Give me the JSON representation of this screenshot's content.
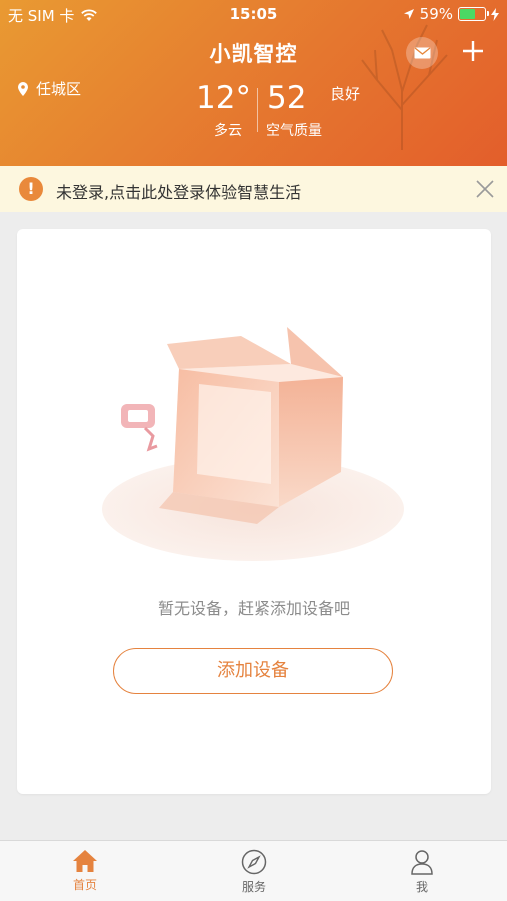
{
  "status_bar": {
    "carrier": "无 SIM 卡",
    "time": "15:05",
    "battery": "59%",
    "battery_level": 0.59,
    "wifi_icon": "wifi-icon",
    "location_icon": "location-arrow-icon"
  },
  "header": {
    "title": "小凯智控",
    "location": "任城区",
    "temperature": "12°",
    "weather": "多云",
    "aqi_value": "52",
    "aqi_label": "空气质量",
    "aqi_level": "良好",
    "mail_icon": "mail-icon",
    "add_icon": "plus-icon",
    "accent_color": "#e5772f"
  },
  "banner": {
    "text": "未登录,点击此处登录体验智慧生活",
    "icon": "warning-icon",
    "close_icon": "close-icon"
  },
  "main": {
    "empty_text": "暂无设备，赶紧添加设备吧",
    "add_button": "添加设备"
  },
  "tabbar": {
    "items": [
      {
        "label": "首页",
        "icon": "home-icon",
        "active": true
      },
      {
        "label": "服务",
        "icon": "compass-icon",
        "active": false
      },
      {
        "label": "我",
        "icon": "user-icon",
        "active": false
      }
    ],
    "active_color": "#e5833f"
  }
}
